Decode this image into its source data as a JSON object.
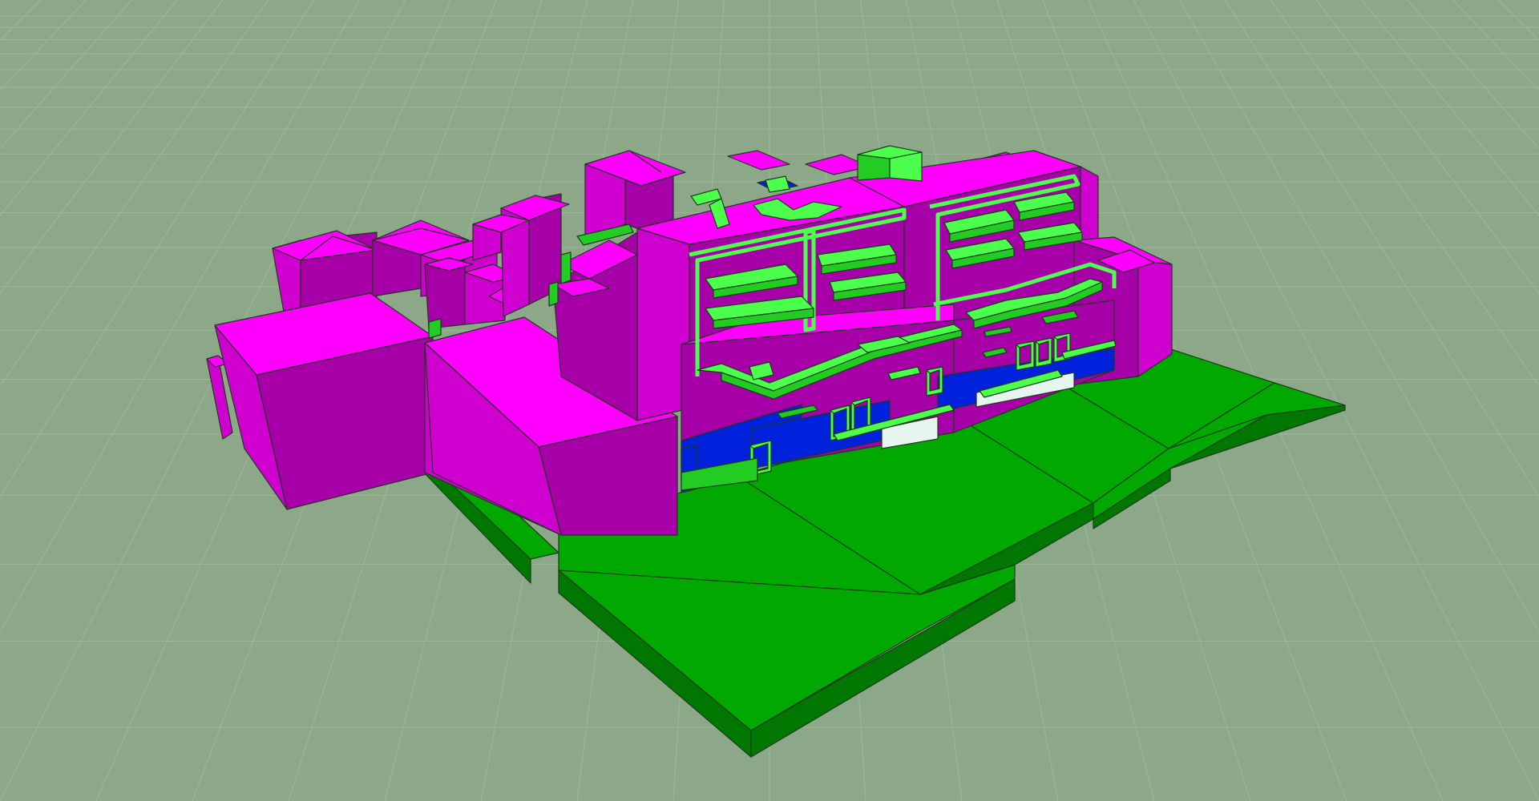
{
  "scene": {
    "background_color": "#8ca889",
    "grid_color": "#9cb79a",
    "outline_color": "#1c3a1c",
    "materials": {
      "building_roof": "#ff00ff",
      "building_side_light": "#d000d0",
      "building_side_dark": "#a800a8",
      "slab_top": "#00a800",
      "slab_side": "#007800",
      "balcony_light": "#4dff4d",
      "balcony_mid": "#22cc22",
      "glazing_blue": "#0022dd",
      "glazing_white": "#e6f5ee"
    }
  }
}
